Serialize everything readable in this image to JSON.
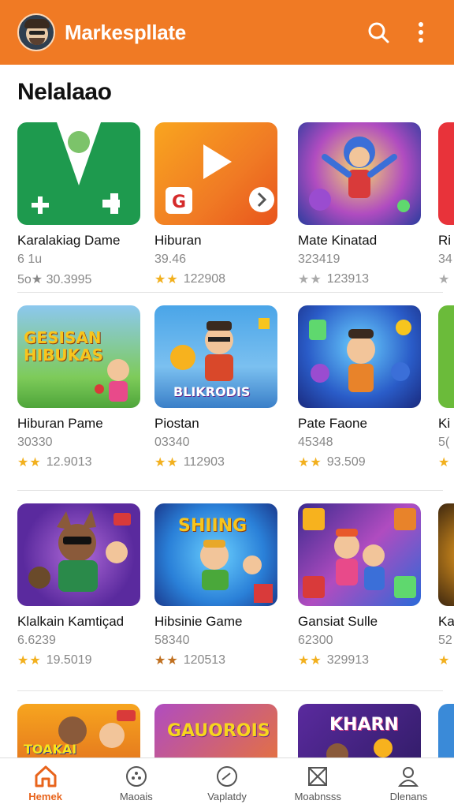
{
  "appbar": {
    "title": "Markespllate",
    "avatar_icon": "avatar-icon",
    "search_icon": "search-icon",
    "more_icon": "more-vert-icon",
    "color": "#f07a24"
  },
  "section": {
    "title": "Nelalaao"
  },
  "cards": [
    {
      "name": "Karalakiag Dame",
      "meta": "6 1u",
      "stars": "",
      "rating": "5o★ 30.3995",
      "thumb_text": ""
    },
    {
      "name": "Hiburan",
      "meta": "39.46",
      "stars": "★★",
      "rating": "122908",
      "thumb_text": ""
    },
    {
      "name": "Mate Kinatad",
      "meta": "323419",
      "stars": "★★",
      "rating": "123913",
      "thumb_text": ""
    },
    {
      "name": "Ri",
      "meta": "34",
      "stars": "★",
      "rating": "",
      "thumb_text": ""
    },
    {
      "name": "Hiburan Pame",
      "meta": "30330",
      "stars": "★★",
      "rating": "12.9013",
      "thumb_text": "GESISAN HIBUKAS"
    },
    {
      "name": "Piostan",
      "meta": "03340",
      "stars": "★★",
      "rating": "112903",
      "thumb_text": "BLIKRODIS"
    },
    {
      "name": "Pate Faone",
      "meta": "45348",
      "stars": "★★",
      "rating": "93.509",
      "thumb_text": ""
    },
    {
      "name": "Ki",
      "meta": "5(",
      "stars": "★",
      "rating": "",
      "thumb_text": ""
    },
    {
      "name": "Klalkain Kamtiçad",
      "meta": "6.6239",
      "stars": "★★",
      "rating": "19.5019",
      "thumb_text": ""
    },
    {
      "name": "Hibsinie Game",
      "meta": "58340",
      "stars": "★★",
      "rating": "120513",
      "thumb_text": "SHIING"
    },
    {
      "name": "Gansiat Sulle",
      "meta": "62300",
      "stars": "★★",
      "rating": "329913",
      "thumb_text": ""
    },
    {
      "name": "Ka",
      "meta": "52",
      "stars": "★",
      "rating": "",
      "thumb_text": ""
    },
    {
      "name": "",
      "meta": "",
      "stars": "",
      "rating": "",
      "thumb_text": "TOAKAI"
    },
    {
      "name": "",
      "meta": "",
      "stars": "",
      "rating": "",
      "thumb_text": "GAUOROIS"
    },
    {
      "name": "",
      "meta": "",
      "stars": "",
      "rating": "",
      "thumb_text": "KHARN"
    }
  ],
  "nav": [
    {
      "label": "Hemek",
      "icon": "home-icon"
    },
    {
      "label": "Maoais",
      "icon": "games-icon"
    },
    {
      "label": "Vaplatdy",
      "icon": "compass-icon"
    },
    {
      "label": "Moabnsss",
      "icon": "library-icon"
    },
    {
      "label": "Dlenans",
      "icon": "profile-icon"
    }
  ]
}
